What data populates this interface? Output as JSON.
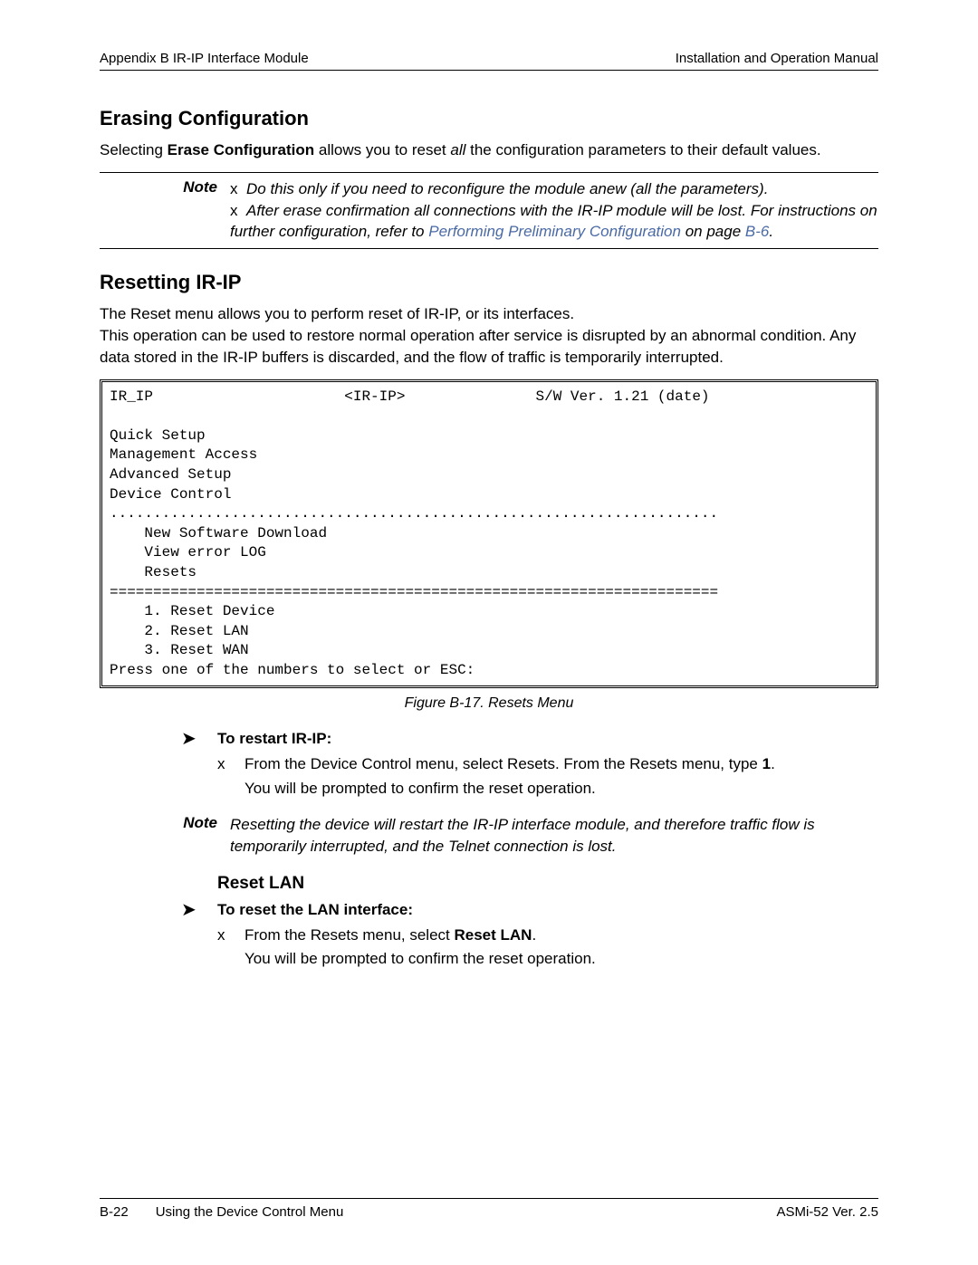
{
  "header": {
    "left": "Appendix B  IR-IP Interface Module",
    "right": "Installation and Operation Manual"
  },
  "section1": {
    "title": "Erasing Configuration",
    "para_pre": "Selecting ",
    "para_bold": "Erase Configuration",
    "para_mid": " allows you to reset ",
    "para_ital": "all",
    "para_post": " the configuration parameters to their default values.",
    "note_label": "Note",
    "note_line1": "Do this only if you need to reconfigure the module anew (all the parameters).",
    "note_line2a": "After erase confirmation all connections with the IR-IP module will be lost. For instructions on further configuration, refer to ",
    "note_link": "Performing Preliminary Configuration",
    "note_line2b": " on page ",
    "note_page": "B-6",
    "note_line2c": "."
  },
  "section2": {
    "title": "Resetting IR-IP",
    "para1": "The Reset menu allows you to perform reset of IR-IP, or its interfaces.",
    "para2": "This operation can be used to restore normal operation after service is disrupted by an abnormal condition. Any data stored in the IR-IP buffers is discarded, and the flow of traffic is temporarily interrupted."
  },
  "terminal": {
    "line_header_left": "IR_IP",
    "line_header_mid": "<IR-IP>",
    "line_header_right": "S/W Ver. 1.21 (date)",
    "items": [
      "Quick Setup",
      "Management Access",
      "Advanced Setup",
      "Device Control"
    ],
    "dots": "......................................................................",
    "sub1": "    New Software Download",
    "sub2": "    View error LOG",
    "sub3": "    Resets",
    "eqs": "======================================================================",
    "opt1": "    1. Reset Device",
    "opt2": "    2. Reset LAN",
    "opt3": "    3. Reset WAN",
    "prompt": "Press one of the numbers to select or ESC:"
  },
  "figcap": "Figure B-17.  Resets Menu",
  "proc1": {
    "title": "To restart IR-IP:",
    "step_pre": "From the Device Control menu, select Resets. From the Resets menu, type ",
    "step_bold": "1",
    "step_post": ".",
    "result": "You will be prompted to confirm the reset operation."
  },
  "note2": {
    "label": "Note",
    "text": "Resetting the device will restart the IR-IP interface module, and therefore traffic flow is temporarily interrupted, and the Telnet connection is lost."
  },
  "subsection": "Reset LAN",
  "proc2": {
    "title": "To reset the LAN interface:",
    "step_pre": "From the Resets menu, select ",
    "step_bold": "Reset LAN",
    "step_post": ".",
    "result": "You will be prompted to confirm the reset operation."
  },
  "footer": {
    "page": "B-22",
    "section": "Using the Device Control Menu",
    "right": "ASMi-52 Ver. 2.5"
  }
}
